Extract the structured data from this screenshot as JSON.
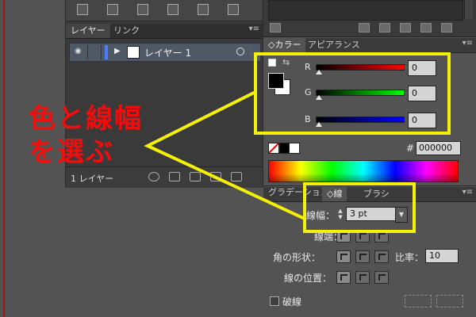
{
  "layers_panel": {
    "tabs": [
      "レイヤー",
      "リンク"
    ],
    "layer_name": "レイヤー 1",
    "layer_count": "1 レイヤー"
  },
  "color_panel": {
    "tabs": [
      "カラー",
      "アピアランス"
    ],
    "channels": [
      {
        "label": "R",
        "value": "0"
      },
      {
        "label": "G",
        "value": "0"
      },
      {
        "label": "B",
        "value": "0"
      }
    ],
    "hash": "#",
    "hex": "000000"
  },
  "stroke_panel": {
    "tabs": [
      "グラデーション",
      "線",
      "ブラシ"
    ],
    "weight_label": "線幅：",
    "weight_value": "3 pt",
    "cap_label": "線端：",
    "corner_label": "角の形状：",
    "ratio_label": "比率：",
    "ratio_value": "10",
    "align_label": "線の位置：",
    "dashed_label": "破線"
  },
  "annotation": {
    "line1": "色と線幅",
    "line2": "を選ぶ",
    "color": "#f20d0d",
    "highlight_color": "#f4f007"
  },
  "icons": [
    "eye-icon",
    "panel-menu-icon",
    "swap-arrow-icon",
    "stepper-icon",
    "dropdown-arrow-icon"
  ]
}
